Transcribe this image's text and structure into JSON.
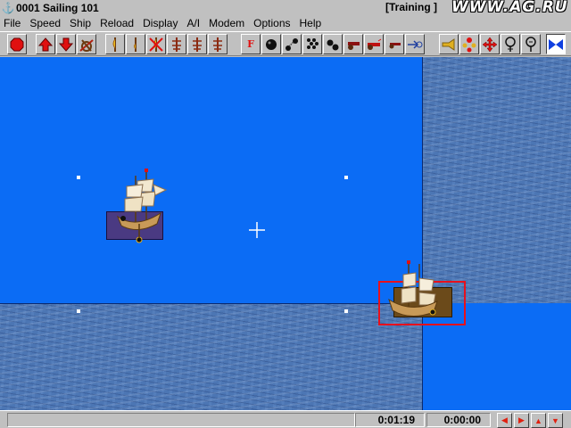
{
  "window": {
    "title": "0001 Sailing 101",
    "mode": "[Training ]",
    "watermark": "WWW.AG.RU",
    "icon": "anchor-icon"
  },
  "menu": [
    "File",
    "Speed",
    "Ship",
    "Reload",
    "Display",
    "A/I",
    "Modem",
    "Options",
    "Help"
  ],
  "toolbar": {
    "groups": [
      [
        "stop-icon"
      ],
      [
        "arrow-up-icon",
        "arrow-down-icon",
        "helm-icon"
      ],
      [
        "sail-full-icon",
        "sail-half-icon",
        "sail-crossed-icon",
        "mast-icon",
        "mast-icon-2",
        "mast-icon-3"
      ],
      [
        "fire-label-icon",
        "roundshot-icon",
        "chainshot-icon",
        "grapeshot-icon",
        "doubleshot-icon",
        "cannon-icon",
        "cannon-red-icon",
        "cannon-small-icon",
        "arrow-target-icon"
      ],
      [
        "trumpet-icon",
        "crew-icon",
        "move-cross-icon",
        "pin-icon",
        "magnify-icon",
        "flag-icon"
      ]
    ],
    "fire_label": "F",
    "colors": {
      "stop": "#e01010",
      "arrows": "#e01010",
      "cannon": "#8b1010",
      "flag": "#1040e0"
    }
  },
  "field": {
    "open_water_color": "#0b6cf5",
    "ocean_color": "#4c76b4",
    "ships": [
      {
        "name": "player-ship",
        "deck_color": "#4a3a82"
      },
      {
        "name": "enemy-ship",
        "deck_color": "#6b4a1a",
        "selected": true
      }
    ],
    "selection_color": "#e8101c"
  },
  "status": {
    "elapsed": "0:01:19",
    "timer": "0:00:00",
    "nav_buttons": [
      "◀",
      "▶",
      "▲",
      "▼"
    ]
  }
}
